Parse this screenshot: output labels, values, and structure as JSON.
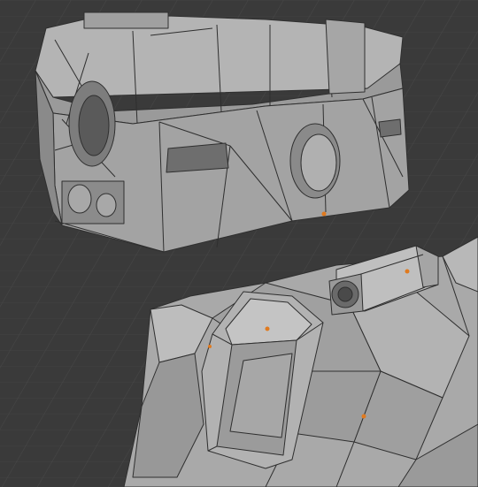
{
  "viewport": {
    "kind": "3d-viewport",
    "shading": "solid",
    "overlays": [
      "wireframe",
      "floor-grid",
      "object-origins"
    ],
    "colors": {
      "background": "#3a3a3a",
      "grid_line": "#474747",
      "mesh_light": "#a9a9a9",
      "mesh_mid": "#8e8e8e",
      "mesh_dark": "#6a6a6a",
      "edge": "#2f2f2f",
      "origin_dot": "#e07a1f"
    }
  },
  "scene": {
    "objects": [
      {
        "id": "box-housing",
        "icon": "mesh-object-icon"
      },
      {
        "id": "turret-body",
        "icon": "mesh-object-icon"
      },
      {
        "id": "turret-hatch",
        "icon": "mesh-object-icon"
      },
      {
        "id": "turret-barrel",
        "icon": "mesh-object-icon"
      }
    ]
  }
}
